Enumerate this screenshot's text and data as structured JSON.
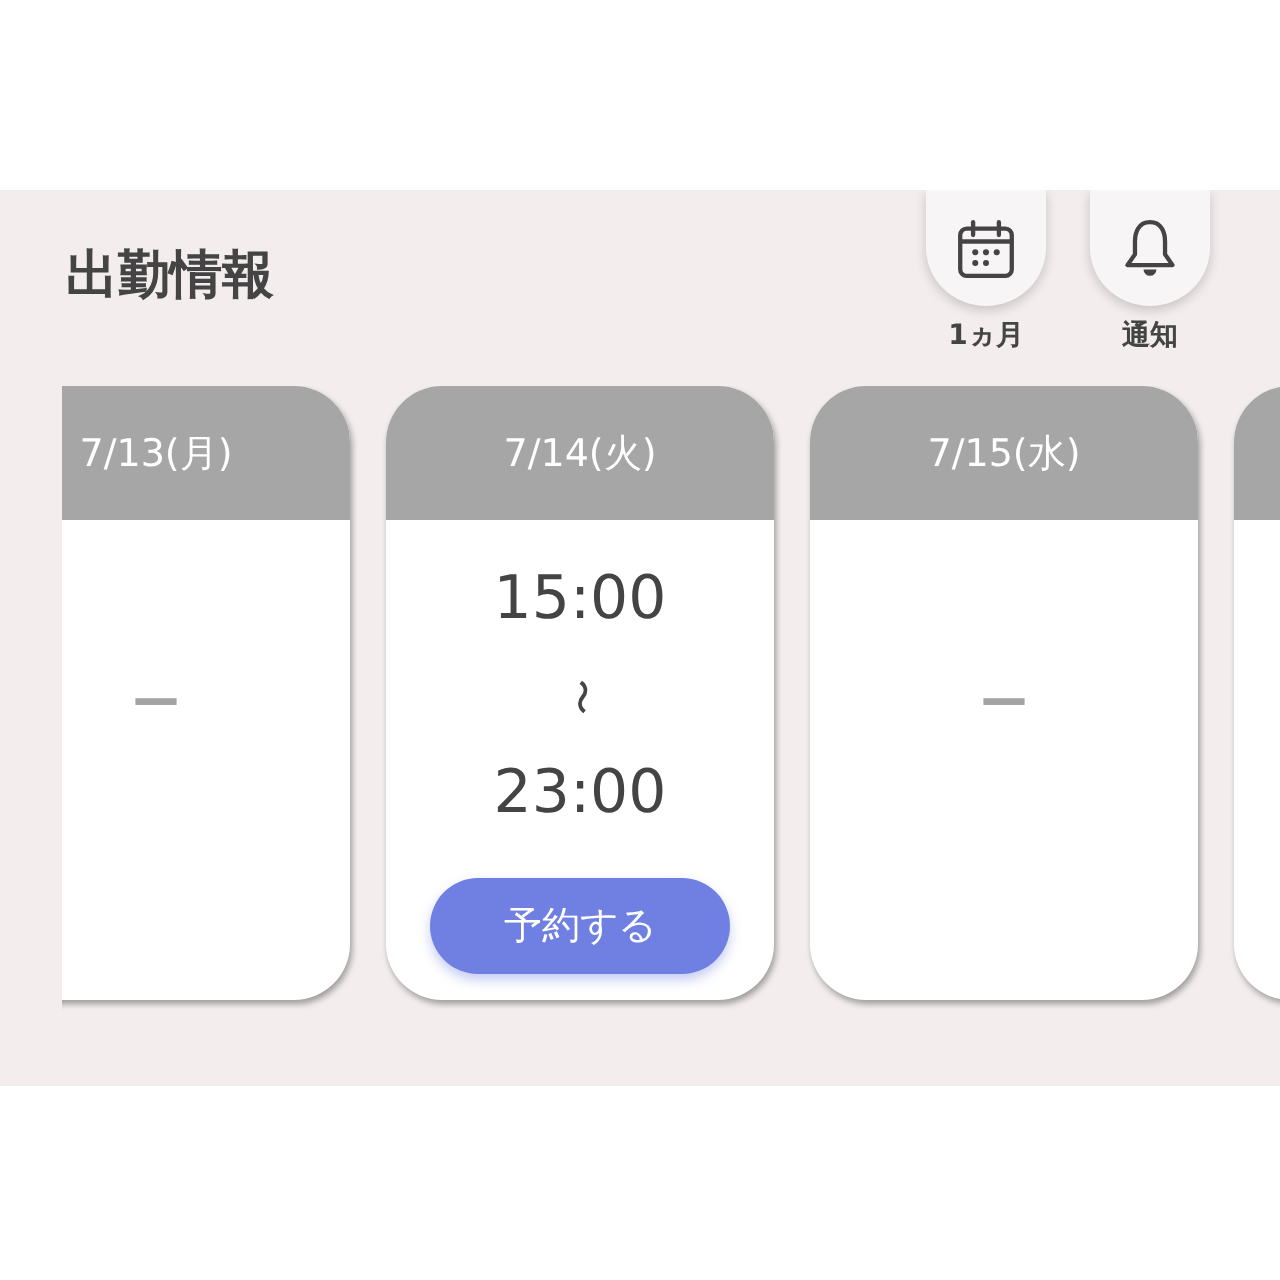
{
  "header": {
    "title": "出勤情報",
    "actions": [
      {
        "kind": "calendar",
        "label": "1ヵ月"
      },
      {
        "kind": "bell",
        "label": "通知"
      }
    ]
  },
  "days": [
    {
      "kind": "off",
      "date": "7/13(月)",
      "text": "ー"
    },
    {
      "kind": "shift",
      "date": "7/14(火)",
      "start": "15:00",
      "separator": "〜",
      "end": "23:00",
      "button": "予約する"
    },
    {
      "kind": "off",
      "date": "7/15(水)",
      "text": "ー"
    },
    {
      "kind": "cut_off"
    }
  ]
}
